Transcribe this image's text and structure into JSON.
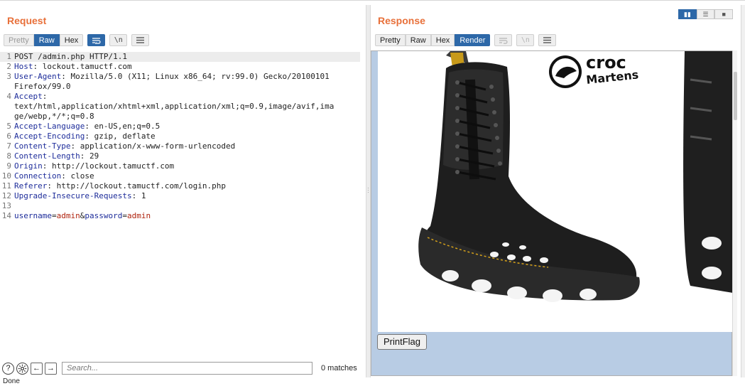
{
  "request": {
    "title": "Request",
    "tabs": [
      "Pretty",
      "Raw",
      "Hex"
    ],
    "active_tab": "Raw",
    "lines": [
      {
        "n": "1",
        "key": "",
        "rest": "POST /admin.php HTTP/1.1"
      },
      {
        "n": "2",
        "key": "Host",
        "rest": ": lockout.tamuctf.com"
      },
      {
        "n": "3",
        "key": "User-Agent",
        "rest": ": Mozilla/5.0 (X11; Linux x86_64; rv:99.0) Gecko/20100101"
      },
      {
        "n": "",
        "key": "",
        "rest": "Firefox/99.0"
      },
      {
        "n": "4",
        "key": "Accept",
        "rest": ":"
      },
      {
        "n": "",
        "key": "",
        "rest": "text/html,application/xhtml+xml,application/xml;q=0.9,image/avif,ima"
      },
      {
        "n": "",
        "key": "",
        "rest": "ge/webp,*/*;q=0.8"
      },
      {
        "n": "5",
        "key": "Accept-Language",
        "rest": ": en-US,en;q=0.5"
      },
      {
        "n": "6",
        "key": "Accept-Encoding",
        "rest": ": gzip, deflate"
      },
      {
        "n": "7",
        "key": "Content-Type",
        "rest": ": application/x-www-form-urlencoded"
      },
      {
        "n": "8",
        "key": "Content-Length",
        "rest": ": 29"
      },
      {
        "n": "9",
        "key": "Origin",
        "rest": ": http://lockout.tamuctf.com"
      },
      {
        "n": "10",
        "key": "Connection",
        "rest": ": close"
      },
      {
        "n": "11",
        "key": "Referer",
        "rest": ": http://lockout.tamuctf.com/login.php"
      },
      {
        "n": "12",
        "key": "Upgrade-Insecure-Requests",
        "rest": ": 1"
      },
      {
        "n": "13",
        "key": "",
        "rest": ""
      }
    ],
    "body_line": {
      "n": "14",
      "k1": "username",
      "eq1": "=",
      "v1": "admin",
      "amp": "&",
      "k2": "password",
      "eq2": "=",
      "v2": "admin"
    },
    "search_placeholder": "Search...",
    "matches": "0 matches",
    "help_glyph": "?",
    "back_glyph": "←",
    "forward_glyph": "→"
  },
  "response": {
    "title": "Response",
    "tabs": [
      "Pretty",
      "Raw",
      "Hex",
      "Render"
    ],
    "active_tab": "Render",
    "logo_line1": "croc",
    "logo_line2": "Martens",
    "button_label": "PrintFlag"
  },
  "status": "Done",
  "colors": {
    "accent": "#e8703a",
    "active_tab": "#2d68a8",
    "render_bg": "#b8cce4",
    "header_key": "#1d2c9a",
    "param_value": "#b0240f"
  }
}
